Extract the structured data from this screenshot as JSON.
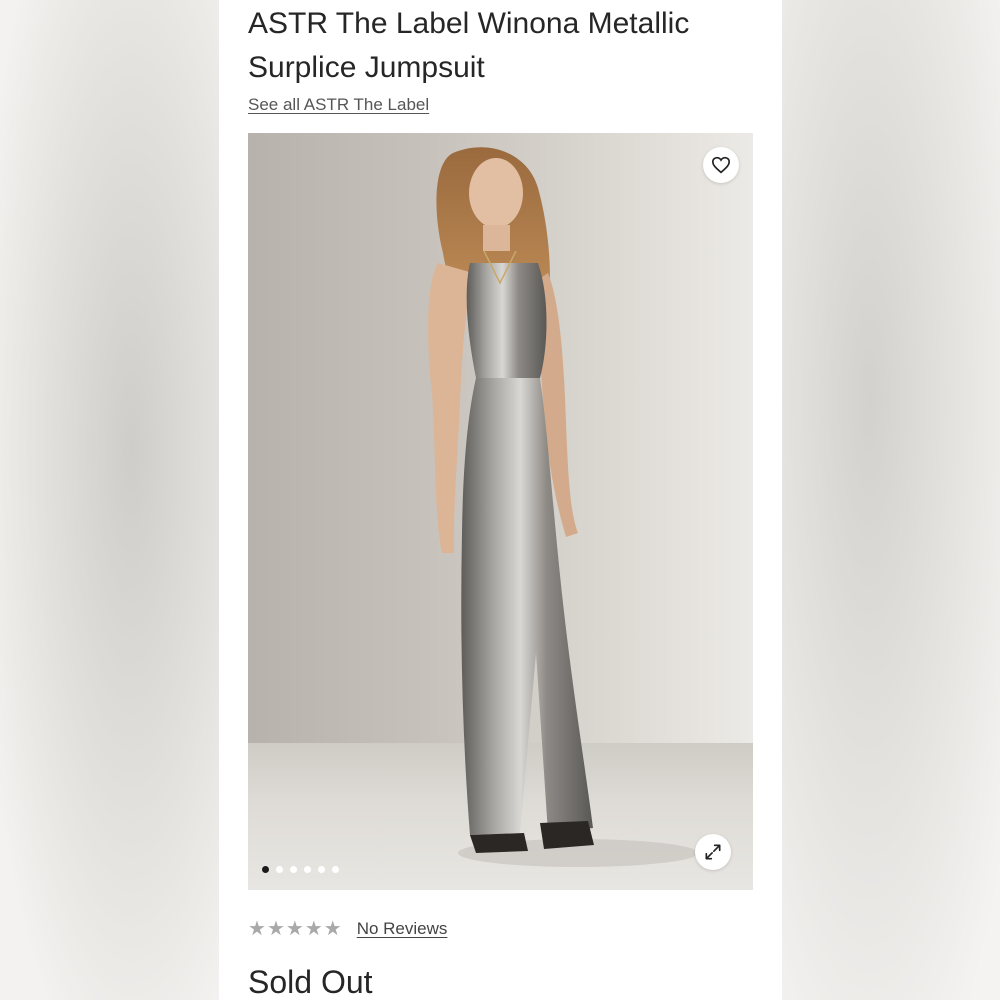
{
  "product": {
    "title_line1": "ASTR The Label Winona Metallic",
    "title_line2": "Surplice Jumpsuit",
    "brand_link": "See all ASTR The Label",
    "status": "Sold Out"
  },
  "gallery": {
    "image_count": 6,
    "active_index": 0,
    "icons": {
      "favorite": "heart-icon",
      "expand": "expand-icon"
    }
  },
  "reviews": {
    "stars": [
      "★",
      "★",
      "★",
      "★",
      "★"
    ],
    "link_label": "No Reviews",
    "star_color": "#a9a9a9"
  }
}
